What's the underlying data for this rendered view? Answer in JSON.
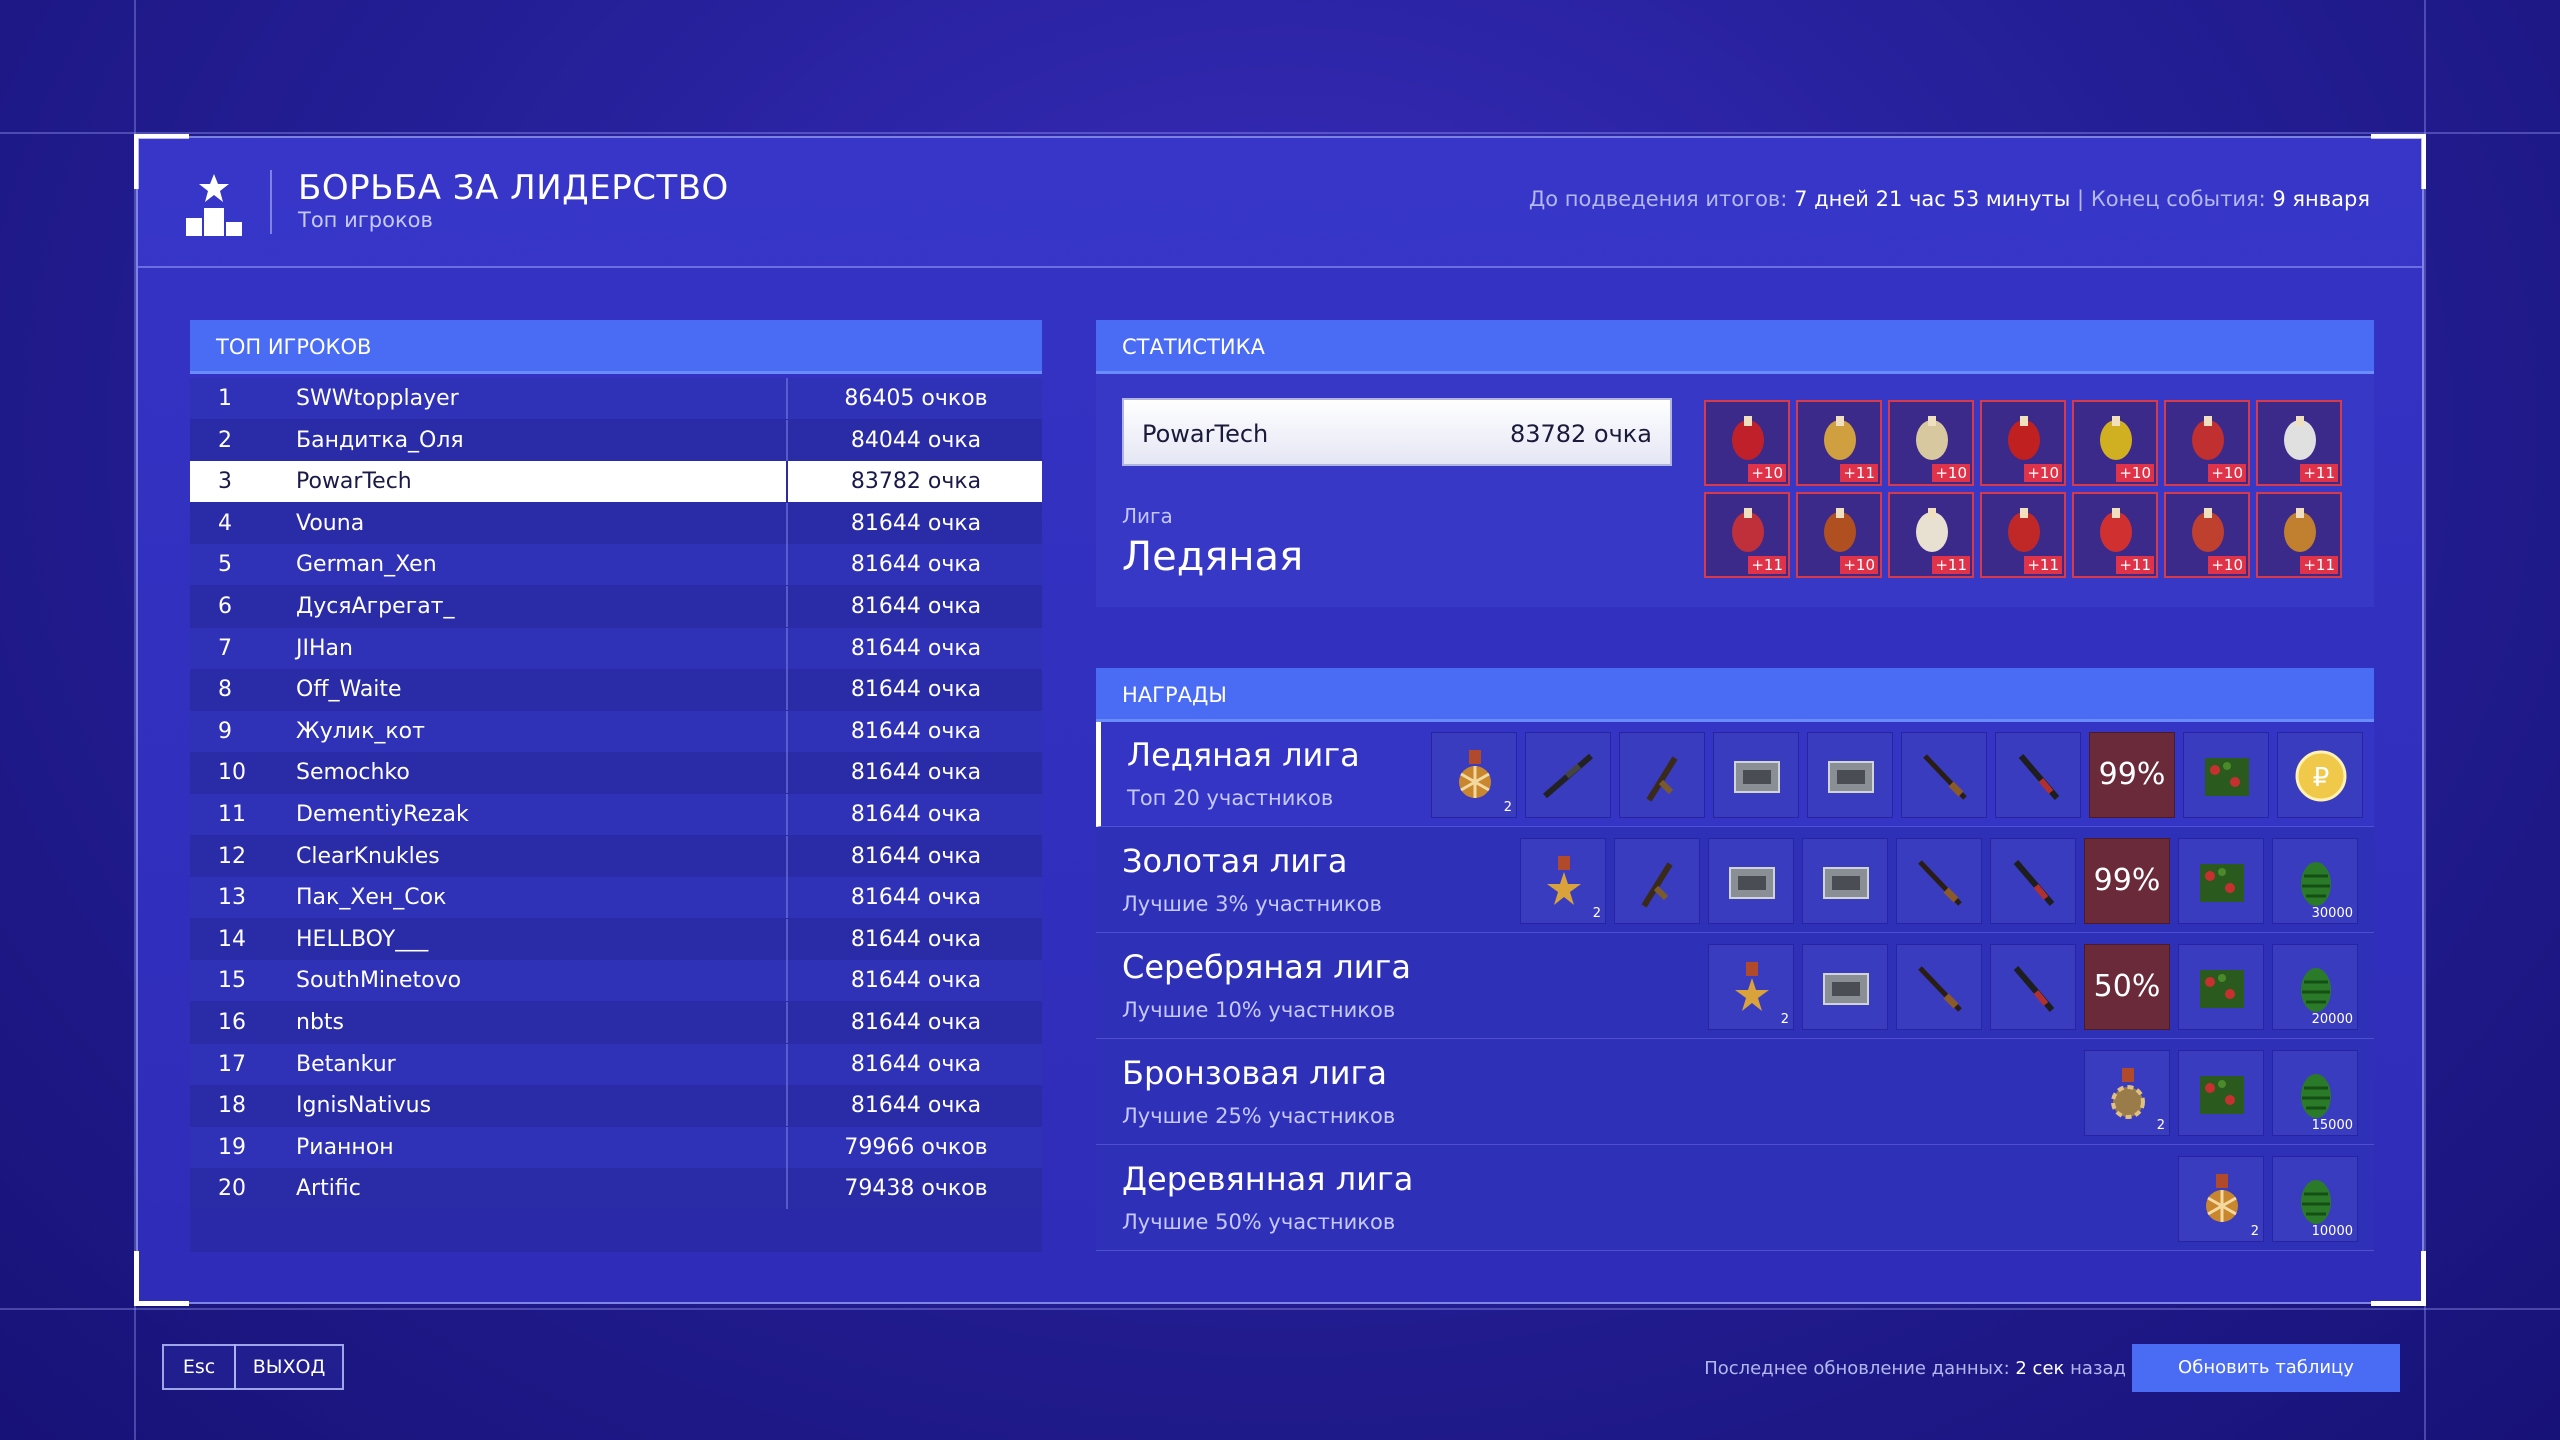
{
  "header": {
    "title": "БОРЬБА ЗА ЛИДЕРСТВО",
    "subtitle": "Топ игроков",
    "timer_label": "До подведения итогов:",
    "timer_value": "7 дней 21 час 53 минуты",
    "separator": "|",
    "end_label": "Конец события:",
    "end_value": "9 января"
  },
  "top": {
    "heading": "ТОП ИГРОКОВ",
    "rows": [
      {
        "n": "1",
        "name": "SWWtopplayer",
        "score": "86405 очков"
      },
      {
        "n": "2",
        "name": "Бандитка_Оля",
        "score": "84044 очка"
      },
      {
        "n": "3",
        "name": "PowarTech",
        "score": "83782 очка"
      },
      {
        "n": "4",
        "name": "Vouna",
        "score": "81644 очка"
      },
      {
        "n": "5",
        "name": "German_Xen",
        "score": "81644 очка"
      },
      {
        "n": "6",
        "name": "ДусяАгрегат_",
        "score": "81644 очка"
      },
      {
        "n": "7",
        "name": "JIHan",
        "score": "81644 очка"
      },
      {
        "n": "8",
        "name": "Off_Waite",
        "score": "81644 очка"
      },
      {
        "n": "9",
        "name": "Жулик_кот",
        "score": "81644 очка"
      },
      {
        "n": "10",
        "name": "Semochko",
        "score": "81644 очка"
      },
      {
        "n": "11",
        "name": "DementiyRezak",
        "score": "81644 очка"
      },
      {
        "n": "12",
        "name": "ClearKnukles",
        "score": "81644 очка"
      },
      {
        "n": "13",
        "name": "Пак_Хен_Сок",
        "score": "81644 очка"
      },
      {
        "n": "14",
        "name": "HELLBOY___",
        "score": "81644 очка"
      },
      {
        "n": "15",
        "name": "SouthMinetovo",
        "score": "81644 очка"
      },
      {
        "n": "16",
        "name": "nbts",
        "score": "81644 очка"
      },
      {
        "n": "17",
        "name": "Betankur",
        "score": "81644 очка"
      },
      {
        "n": "18",
        "name": "IgnisNativus",
        "score": "81644 очка"
      },
      {
        "n": "19",
        "name": "Рианнон",
        "score": "79966 очков"
      },
      {
        "n": "20",
        "name": "Artific",
        "score": "79438 очков"
      }
    ],
    "selected": "3"
  },
  "stats": {
    "heading": "СТАТИСТИКА",
    "player": "PowarTech",
    "score": "83782 очка",
    "league_label": "Лига",
    "league_value": "Ледяная",
    "items": [
      {
        "icon": "bomb-icon",
        "badge": "+10"
      },
      {
        "icon": "rope-ladder-icon",
        "badge": "+11"
      },
      {
        "icon": "gift-box-icon",
        "badge": "+10"
      },
      {
        "icon": "grenade-icon",
        "badge": "+10"
      },
      {
        "icon": "ornament-icon",
        "badge": "+10"
      },
      {
        "icon": "bell-icon",
        "badge": "+10"
      },
      {
        "icon": "bow-bells-icon",
        "badge": "+11"
      },
      {
        "icon": "ribbon-icon",
        "badge": "+11"
      },
      {
        "icon": "bench-icon",
        "badge": "+10"
      },
      {
        "icon": "cards-icon",
        "badge": "+11"
      },
      {
        "icon": "boot-icon",
        "badge": "+11"
      },
      {
        "icon": "candy-cane-icon",
        "badge": "+11"
      },
      {
        "icon": "tag-icon",
        "badge": "+10"
      },
      {
        "icon": "present-icon",
        "badge": "+11"
      }
    ]
  },
  "rewards": {
    "heading": "НАГРАДЫ",
    "leagues": [
      {
        "name": "Ледяная лига",
        "desc": "Топ 20 участников",
        "slots": [
          {
            "icon": "snowflake-medal-icon",
            "count": "2"
          },
          {
            "icon": "sniper-rifle-icon"
          },
          {
            "icon": "pistol-icon"
          },
          {
            "icon": "ammo-box-icon"
          },
          {
            "icon": "ammo-box-icon"
          },
          {
            "icon": "rifle-icon"
          },
          {
            "icon": "shotgun-icon"
          },
          {
            "pct": "99%"
          },
          {
            "icon": "crate-icon"
          },
          {
            "icon": "coin-icon"
          }
        ]
      },
      {
        "name": "Золотая лига",
        "desc": "Лучшие 3% участников",
        "slots": [
          {
            "icon": "star-medal-icon",
            "count": "2"
          },
          {
            "icon": "pistol-icon"
          },
          {
            "icon": "ammo-box-icon"
          },
          {
            "icon": "ammo-box-icon"
          },
          {
            "icon": "rifle-icon"
          },
          {
            "icon": "shotgun-icon"
          },
          {
            "pct": "99%"
          },
          {
            "icon": "crate-icon"
          },
          {
            "icon": "cone-icon",
            "count": "30000"
          }
        ]
      },
      {
        "name": "Серебряная лига",
        "desc": "Лучшие 10% участников",
        "slots": [
          {
            "icon": "star-medal-icon",
            "count": "2"
          },
          {
            "icon": "ammo-box-icon"
          },
          {
            "icon": "rifle-icon"
          },
          {
            "icon": "shotgun-icon"
          },
          {
            "pct": "50%"
          },
          {
            "icon": "crate-icon"
          },
          {
            "icon": "cone-icon",
            "count": "20000"
          }
        ]
      },
      {
        "name": "Бронзовая лига",
        "desc": "Лучшие 25% участников",
        "slots": [
          {
            "icon": "gear-medal-icon",
            "count": "2"
          },
          {
            "icon": "crate-icon"
          },
          {
            "icon": "cone-icon",
            "count": "15000"
          }
        ]
      },
      {
        "name": "Деревянная лига",
        "desc": "Лучшие 50% участников",
        "slots": [
          {
            "icon": "snowflake-medal-icon",
            "count": "2"
          },
          {
            "icon": "cone-icon",
            "count": "10000"
          }
        ]
      }
    ]
  },
  "footer": {
    "esc": "Esc",
    "exit": "ВЫХОД",
    "upd_label": "Последнее обновление данных:",
    "upd_value": "2 сек",
    "upd_suffix": "назад",
    "refresh": "Обновить таблицу"
  },
  "colors": {
    "accent": "#4a6cf5",
    "badge": "#e0334a",
    "panel": "#2f30b8"
  }
}
